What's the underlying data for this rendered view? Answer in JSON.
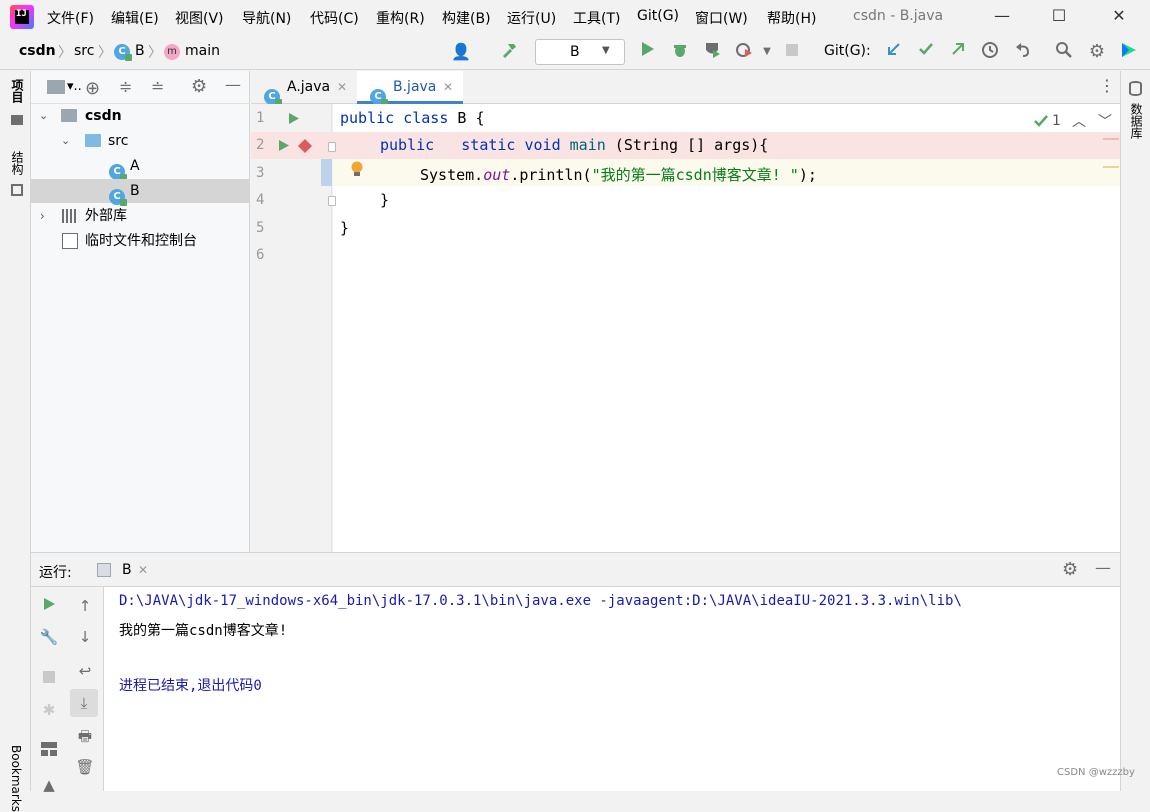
{
  "window": {
    "title": "csdn - B.java",
    "logo_text": "IJ",
    "minimize": "—",
    "maximize": "☐",
    "close": "✕"
  },
  "menu": [
    "文件(F)",
    "编辑(E)",
    "视图(V)",
    "导航(N)",
    "代码(C)",
    "重构(R)",
    "构建(B)",
    "运行(U)",
    "工具(T)",
    "Git(G)",
    "窗口(W)",
    "帮助(H)"
  ],
  "breadcrumb": {
    "project": "csdn",
    "folder": "src",
    "class": "B",
    "method": "main",
    "class_icon": "C",
    "method_icon": "m",
    "separator": "〉"
  },
  "toolbar": {
    "run_config": "B",
    "git_label": "Git(G):"
  },
  "left_strip": {
    "project_tab": "项目",
    "structure_tab": "结构",
    "bookmarks_tab": "Bookmarks"
  },
  "right_strip": {
    "database_tab": "数据库"
  },
  "project_panel": {
    "title": "▾..",
    "tree": [
      {
        "label": "csdn",
        "type": "project"
      },
      {
        "label": "src",
        "type": "folder"
      },
      {
        "label": "A",
        "type": "class"
      },
      {
        "label": "B",
        "type": "class",
        "selected": true
      },
      {
        "label": "外部库",
        "type": "library"
      },
      {
        "label": "临时文件和控制台",
        "type": "scratch"
      }
    ]
  },
  "editor": {
    "tabs": [
      {
        "label": "A.java",
        "active": false
      },
      {
        "label": "B.java",
        "active": true
      }
    ],
    "inspection_count": "1",
    "line_numbers": [
      "1",
      "2",
      "3",
      "4",
      "5",
      "6"
    ],
    "code": {
      "l1_kw": "public class",
      "l1_rest": " B {",
      "l2_kw1": "public",
      "l2_kw2": "static void",
      "l2_meth": "main",
      "l2_rest": " (String [] args){",
      "l3_a": "System.",
      "l3_field": "out",
      "l3_b": ".println(",
      "l3_str": "\"我的第一篇csdn博客文章! \"",
      "l3_c": ");",
      "l4": "}",
      "l5": "}"
    }
  },
  "run_panel": {
    "label": "运行:",
    "tab": "B",
    "output": [
      "D:\\JAVA\\jdk-17_windows-x64_bin\\jdk-17.0.3.1\\bin\\java.exe -javaagent:D:\\JAVA\\ideaIU-2021.3.3.win\\lib\\",
      "我的第一篇csdn博客文章!",
      "",
      "进程已结束,退出代码0"
    ]
  },
  "watermark": "CSDN @wzzzby",
  "colors": {
    "keyword": "#0033b3",
    "string": "#067d17",
    "field": "#871094",
    "run_green": "#59a869",
    "breakpoint_red": "#db5c5c",
    "accent_blue": "#4083c9"
  }
}
